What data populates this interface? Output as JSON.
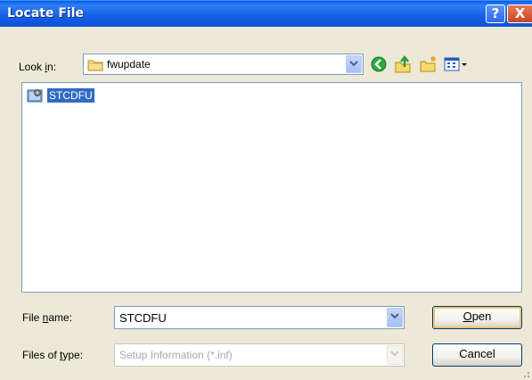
{
  "window": {
    "title": "Locate File",
    "help_glyph": "?",
    "close_glyph": "X"
  },
  "toolbar": {
    "look_in_label_pre": "Look ",
    "look_in_label_key": "i",
    "look_in_label_post": "n:",
    "look_in_value": "fwupdate",
    "icons": [
      "back-icon",
      "up-folder-icon",
      "new-folder-icon",
      "view-menu-icon"
    ]
  },
  "file_list": {
    "items": [
      {
        "label": "STCDFU",
        "icon": "setup-file-icon",
        "selected": true
      }
    ]
  },
  "file_name": {
    "label_pre": "File ",
    "label_key": "n",
    "label_post": "ame:",
    "value": "STCDFU"
  },
  "file_type": {
    "label_pre": "Files of ",
    "label_key": "t",
    "label_post": "ype:",
    "value": "Setup Information (*.inf)"
  },
  "buttons": {
    "open_key": "O",
    "open_rest": "pen",
    "cancel": "Cancel"
  },
  "colors": {
    "title_bar": "#0d51d6",
    "selection": "#316ac5",
    "dialog_bg": "#ece9d8"
  }
}
